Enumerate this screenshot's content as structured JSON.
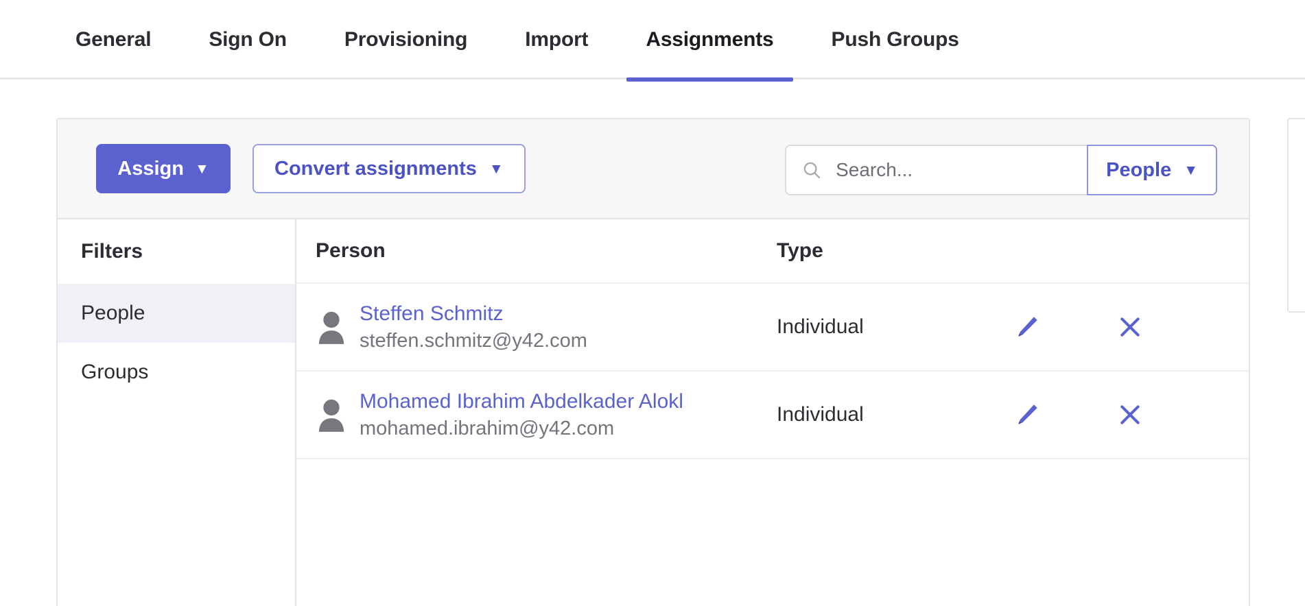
{
  "tabs": [
    {
      "label": "General",
      "active": false
    },
    {
      "label": "Sign On",
      "active": false
    },
    {
      "label": "Provisioning",
      "active": false
    },
    {
      "label": "Import",
      "active": false
    },
    {
      "label": "Assignments",
      "active": true
    },
    {
      "label": "Push Groups",
      "active": false
    }
  ],
  "toolbar": {
    "assign_label": "Assign",
    "assign_caret": "▼",
    "convert_label": "Convert assignments",
    "convert_caret": "▼",
    "search_placeholder": "Search...",
    "search_value": "",
    "search_icon": "search-icon",
    "people_filter_label": "People",
    "people_filter_caret": "▼"
  },
  "filters": {
    "heading": "Filters",
    "items": [
      {
        "label": "People",
        "selected": true
      },
      {
        "label": "Groups",
        "selected": false
      }
    ]
  },
  "table": {
    "columns": {
      "person": "Person",
      "type": "Type"
    },
    "rows": [
      {
        "name": "Steffen Schmitz",
        "email": "steffen.schmitz@y42.com",
        "type": "Individual",
        "avatar_icon": "person-avatar-icon",
        "edit_icon": "pencil-icon",
        "remove_icon": "close-icon"
      },
      {
        "name": "Mohamed Ibrahim Abdelkader Alokl",
        "email": "mohamed.ibrahim@y42.com",
        "type": "Individual",
        "avatar_icon": "person-avatar-icon",
        "edit_icon": "pencil-icon",
        "remove_icon": "close-icon"
      }
    ]
  },
  "colors": {
    "accent": "#5b62d0",
    "accent_text": "#4b53c4",
    "selected_row_bg": "#f0f1f7",
    "toolbar_bg": "#f7f7f8",
    "border": "#e2e3e7",
    "text": "#2b2d32",
    "muted_text": "#73757c"
  }
}
